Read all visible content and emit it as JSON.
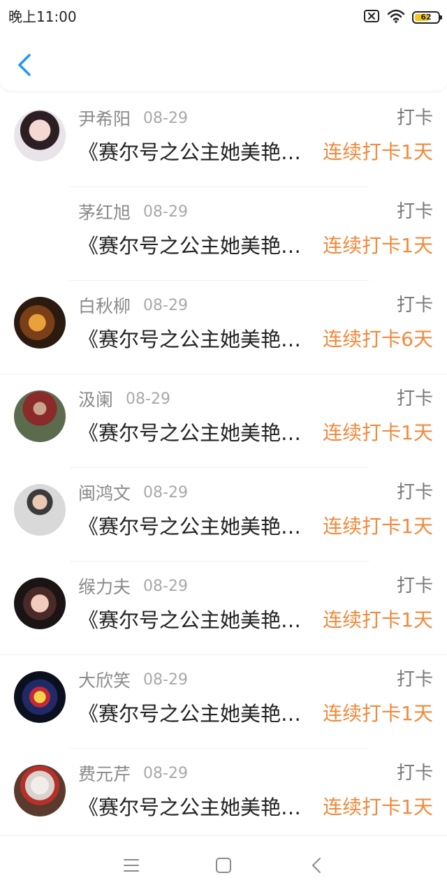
{
  "status_bar": {
    "time": "晚上11:00",
    "battery_level": "62",
    "battery_fraction": 0.62,
    "icons": [
      "sim-missing-icon",
      "wifi-icon",
      "battery-icon"
    ]
  },
  "nav": {
    "back_icon": "chevron-left-icon",
    "accent_color": "#2196f3"
  },
  "colors": {
    "streak": "#f08a3c",
    "name": "#8a8a8a",
    "text": "#222222"
  },
  "list": [
    {
      "name": "尹希阳",
      "date": "08-29",
      "action": "打卡",
      "book": "《赛尔号之公主她美艳动人》",
      "streak": "连续打卡1天",
      "has_avatar": true
    },
    {
      "name": "茅红旭",
      "date": "08-29",
      "action": "打卡",
      "book": "《赛尔号之公主她美艳动人》",
      "streak": "连续打卡1天",
      "has_avatar": false
    },
    {
      "name": "白秋柳",
      "date": "08-29",
      "action": "打卡",
      "book": "《赛尔号之公主她美艳动人》",
      "streak": "连续打卡6天",
      "has_avatar": true
    },
    {
      "name": "汲阑",
      "date": "08-29",
      "action": "打卡",
      "book": "《赛尔号之公主她美艳动人》",
      "streak": "连续打卡1天",
      "has_avatar": true
    },
    {
      "name": "闽鸿文",
      "date": "08-29",
      "action": "打卡",
      "book": "《赛尔号之公主她美艳动人》",
      "streak": "连续打卡1天",
      "has_avatar": true
    },
    {
      "name": "缑力夫",
      "date": "08-29",
      "action": "打卡",
      "book": "《赛尔号之公主她美艳动人》",
      "streak": "连续打卡1天",
      "has_avatar": true
    },
    {
      "name": "大欣笑",
      "date": "08-29",
      "action": "打卡",
      "book": "《赛尔号之公主她美艳动人》",
      "streak": "连续打卡1天",
      "has_avatar": true
    },
    {
      "name": "费元芹",
      "date": "08-29",
      "action": "打卡",
      "book": "《赛尔号之公主她美艳动人》",
      "streak": "连续打卡1天",
      "has_avatar": true
    }
  ],
  "bottom_nav": {
    "icons": [
      "menu-icon",
      "home-square-icon",
      "back-triangle-icon"
    ]
  }
}
